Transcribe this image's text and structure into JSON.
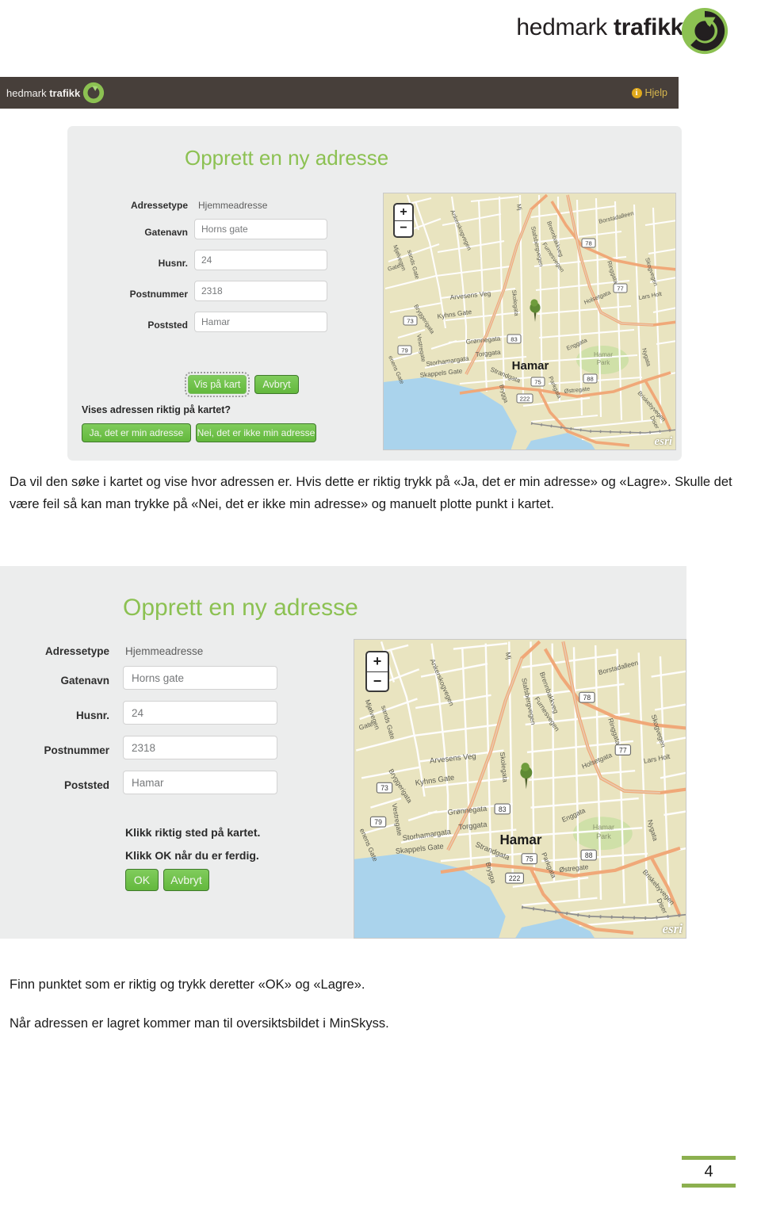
{
  "brand": {
    "name_thin": "hedmark ",
    "name_bold": "trafikk",
    "logo_icon": "circular-arrow-logo"
  },
  "screenshot1": {
    "appbar": {
      "brand_thin": "hedmark ",
      "brand_bold": "trafikk",
      "help_label": "Hjelp",
      "help_icon": "info-icon"
    },
    "form": {
      "title": "Opprett en ny adresse",
      "fields": [
        {
          "label": "Adressetype",
          "value": "Hjemmeadresse",
          "type": "static"
        },
        {
          "label": "Gatenavn",
          "value": "Horns gate",
          "type": "input"
        },
        {
          "label": "Husnr.",
          "value": "24",
          "type": "input"
        },
        {
          "label": "Postnummer",
          "value": "2318",
          "type": "input"
        },
        {
          "label": "Poststed",
          "value": "Hamar",
          "type": "input"
        }
      ],
      "primary_button": "Vis på kart",
      "cancel_button": "Avbryt",
      "question": "Vises adressen riktig på kartet?",
      "yes_button": "Ja, det er min adresse",
      "no_button": "Nei, det er ikke min adresse"
    }
  },
  "screenshot2": {
    "form": {
      "title": "Opprett en ny adresse",
      "fields": [
        {
          "label": "Adressetype",
          "value": "Hjemmeadresse",
          "type": "static"
        },
        {
          "label": "Gatenavn",
          "value": "Horns gate",
          "type": "input"
        },
        {
          "label": "Husnr.",
          "value": "24",
          "type": "input"
        },
        {
          "label": "Postnummer",
          "value": "2318",
          "type": "input"
        },
        {
          "label": "Poststed",
          "value": "Hamar",
          "type": "input"
        }
      ],
      "instruction_1": "Klikk riktig sted på kartet.",
      "instruction_2": "Klikk OK når du er ferdig.",
      "ok_button": "OK",
      "cancel_button": "Avbryt"
    }
  },
  "map": {
    "attribution": "esri",
    "zoom_in": "+",
    "zoom_out": "−",
    "city_label": "Hamar",
    "park_label_1": "Hamar",
    "park_label_2": "Park",
    "marker_icon": "map-pin-marker",
    "street_labels": [
      "Ankerskogvegen",
      "Stafsbergvegen",
      "Brennbakkveg",
      "Furnesvegen",
      "Borstadalleen",
      "Ringgata",
      "Skogvegen",
      "Holsetgata",
      "Lars Holt",
      "Arvesens Veg",
      "Skolegata",
      "Kyhns Gate",
      "Grønnegata",
      "Torggata",
      "Storhamargata",
      "Skappels Gate",
      "Strandgata",
      "Brygga",
      "Enggata",
      "Parkgata",
      "Østregate",
      "Nygata",
      "Briskebyvegen",
      "Vestregate",
      "Bryggerigata",
      "Mjøsa",
      "Diser",
      "Mjølvegen",
      "sands Gate",
      "Gate",
      "enens Gate"
    ],
    "route_shields": [
      "78",
      "77",
      "73",
      "79",
      "83",
      "75",
      "88",
      "222"
    ]
  },
  "body": {
    "paragraph_1": "Da vil den søke i kartet og vise hvor adressen er. Hvis dette er riktig trykk på «Ja, det er min adresse» og «Lagre». Skulle det være feil så kan man trykke på «Nei, det er ikke min adresse» og manuelt plotte punkt i kartet.",
    "paragraph_2": "Finn punktet som er riktig og trykk deretter «OK» og «Lagre».",
    "paragraph_3": "Når adressen er lagret kommer man til oversiktsbildet i MinSkyss."
  },
  "footer": {
    "page_number": "4",
    "rule_color": "#8cb04f"
  },
  "colors": {
    "brand_green": "#8cc152",
    "button_green": "#6fc34a",
    "appbar_dark": "#473f3a",
    "panel_gray": "#eceded",
    "help_gold": "#d8b84e"
  }
}
